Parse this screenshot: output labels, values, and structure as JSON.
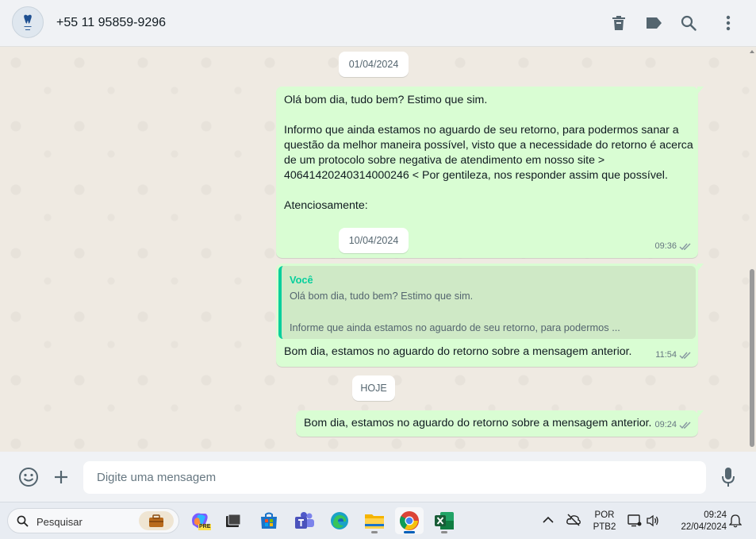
{
  "header": {
    "contact": "+55 11 95859-9296",
    "icons": [
      "delete-icon",
      "label-icon",
      "search-icon",
      "menu-icon"
    ]
  },
  "chat": {
    "dates": [
      "01/04/2024",
      "10/04/2024",
      "HOJE"
    ],
    "messages": [
      {
        "text": "Olá bom dia, tudo bem? Estimo que sim.\n\nInformo que ainda estamos no aguardo de seu retorno, para podermos sanar a\nquestão da melhor maneira possível, visto que a necessidade do retorno é acerca\nde um protocolo sobre negativa de atendimento em nosso site >\n40641420240314000246 < Por gentileza, nos responder assim que possível.\n\nAtenciosamente:",
        "time": "09:36"
      },
      {
        "quote_author": "Você",
        "quote_text": "Olá bom dia, tudo bem? Estimo que sim.\n\nInforme que ainda estamos no aguardo de seu retorno, para podermos ...",
        "text": "Bom dia, estamos no aguardo do retorno sobre a mensagem anterior.",
        "time": "11:54"
      },
      {
        "text": "Bom dia, estamos no aguardo do retorno sobre a mensagem anterior.",
        "time": "09:24"
      }
    ]
  },
  "composer": {
    "placeholder": "Digite uma mensagem"
  },
  "taskbar": {
    "search_placeholder": "Pesquisar",
    "apps": [
      "copilot-pre",
      "task-view",
      "microsoft-store",
      "teams",
      "edge",
      "file-explorer",
      "chrome",
      "excel"
    ],
    "copilot_badge": "PRE",
    "language_top": "POR",
    "language_bottom": "PTB2",
    "time": "09:24",
    "date": "22/04/2024"
  },
  "colors": {
    "bubble_out": "#d9fdd3",
    "accent_quote": "#06cf9c",
    "chat_bg": "#efeae2"
  }
}
